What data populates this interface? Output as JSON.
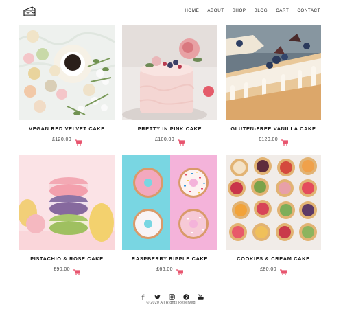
{
  "header": {
    "logo_icon": "cake-icon",
    "nav": [
      {
        "label": "HOME"
      },
      {
        "label": "ABOUT"
      },
      {
        "label": "SHOP"
      },
      {
        "label": "BLOG"
      },
      {
        "label": "CART"
      },
      {
        "label": "CONTACT"
      }
    ]
  },
  "products": [
    {
      "name": "VEGAN RED VELVET CAKE",
      "price": "£120.00",
      "image": "macarons-and-coffee-photo"
    },
    {
      "name": "PRETTY IN PINK CAKE",
      "price": "£100.00",
      "image": "pink-cake-photo"
    },
    {
      "name": "GLUTEN-FREE VANILLA CAKE",
      "price": "£120.00",
      "image": "vanilla-cake-blueberry-photo"
    },
    {
      "name": "PISTACHIO & ROSE CAKE",
      "price": "£90.00",
      "image": "macaron-stack-photo"
    },
    {
      "name": "RASPBERRY RIPPLE CAKE",
      "price": "£66.00",
      "image": "donuts-photo"
    },
    {
      "name": "COOKIES & CREAM CAKE",
      "price": "£80.00",
      "image": "fruit-tarts-photo"
    }
  ],
  "cart_icon": "shopping-cart-icon",
  "colors": {
    "accent": "#e8546e",
    "text": "#222222"
  },
  "footer": {
    "social": [
      "facebook-icon",
      "twitter-icon",
      "instagram-icon",
      "pinterest-icon",
      "youtube-icon"
    ],
    "copyright": "© 2020 All Rights Reserved."
  }
}
